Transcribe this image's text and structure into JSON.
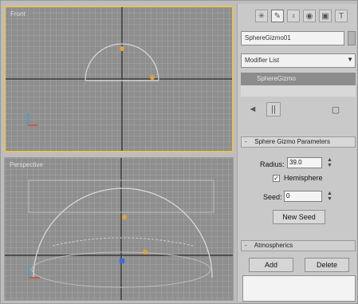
{
  "viewports": {
    "top": {
      "label": "Front"
    },
    "perspective": {
      "label": "Perspective"
    }
  },
  "command_panel": {
    "tabs": [
      {
        "icon": "create-icon",
        "glyph": "✳"
      },
      {
        "icon": "modify-icon",
        "glyph": "✎"
      },
      {
        "icon": "hierarchy-icon",
        "glyph": "♁"
      },
      {
        "icon": "motion-icon",
        "glyph": "◉"
      },
      {
        "icon": "display-icon",
        "glyph": "▣"
      },
      {
        "icon": "utilities-icon",
        "glyph": "T"
      }
    ],
    "object_name": "SphereGizmo01",
    "modifier_list": "Modifier List",
    "stack_item": "SphereGizmo",
    "tools": {
      "pin": "◄",
      "pause": "||",
      "config": "▢"
    },
    "params_rollout": {
      "sign": "-",
      "title": "Sphere Gizmo Parameters",
      "radius_label": "Radius:",
      "radius_value": "39.0",
      "hemisphere_label": "Hemisphere",
      "hemisphere_checked": "✓",
      "seed_label": "Seed:",
      "seed_value": "0",
      "new_seed_label": "New Seed"
    },
    "atmospherics_rollout": {
      "sign": "-",
      "title": "Atmospherics",
      "add_label": "Add",
      "delete_label": "Delete"
    }
  },
  "colors": {
    "active_viewport_border": "#e6c25a",
    "viewport_bg": "#8e8e8e"
  }
}
